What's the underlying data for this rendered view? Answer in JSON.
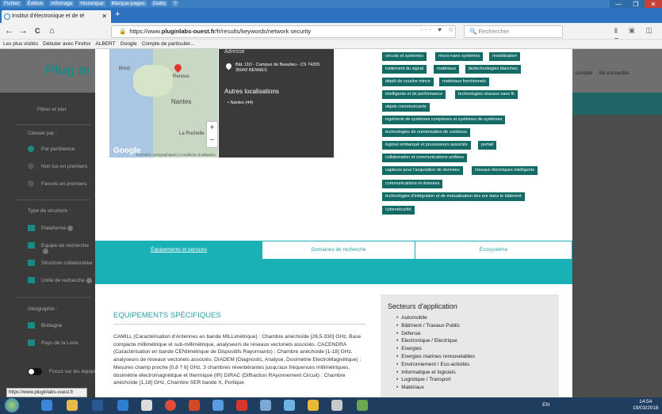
{
  "menubar": {
    "items": [
      "Fichier",
      "Édition",
      "Affichage",
      "Historique",
      "Marque-pages",
      "Outils",
      "?"
    ]
  },
  "window": {
    "minimize": "—",
    "restore": "❐",
    "close": "✕"
  },
  "tab": {
    "title": "Institut d'électronique et de té",
    "close": "✕",
    "new": "+"
  },
  "nav": {
    "back": "←",
    "forward": "→",
    "reload": "C",
    "home": "⌂"
  },
  "url": {
    "prefix": "https://www.",
    "domain": "pluginlabs-ouest.fr",
    "path": "/fr/results/keywords/network security",
    "icons": "··· ♥ ☆"
  },
  "search": {
    "placeholder": "Rechercher"
  },
  "toolbar_right": "⫴ ▣ ◫ ≡",
  "bookmarks": [
    "Les plus visités",
    "Débuter avec Firefox",
    "ALBERT",
    "Google",
    "Compte de particulier..."
  ],
  "site": {
    "logo": "Plug in",
    "links": [
      "compte",
      "Se connecter"
    ]
  },
  "sidebar": {
    "filter": "Filtrer et trier",
    "sort_label": "Classer par :",
    "sort_options": [
      "Par pertinence",
      "Non lus en premiers",
      "Favoris en premiers"
    ],
    "type_label": "Type de structure :",
    "types": [
      "Plateforme",
      "Equipe de recherche",
      "Structure collaborative",
      "Unité de recherche"
    ],
    "geo_label": "Géographie :",
    "regions": [
      "Bretagne",
      "Pays de la Loire"
    ],
    "focus": "Focus sur les équipements"
  },
  "map": {
    "labels": [
      "Brest",
      "Rennes",
      "Nantes",
      "La Rochelle"
    ],
    "zoom_in": "+",
    "zoom_out": "−",
    "google": "Google",
    "credits": "Données cartographiques | Conditions d'utilisation"
  },
  "address": {
    "heading": "Adresse",
    "line1": "Bât. 11D - Campus de Beaulieu - CS 74205",
    "line2": "35042 RENNES",
    "other_heading": "Autres localisations",
    "other_item": "Nantes (44)"
  },
  "tags": [
    "circuits et systèmes",
    "micro-nano systèmes",
    "modélisation",
    "traitement du signal",
    "matériaux",
    "biotechnologies blanches",
    "dépôt de couche mince",
    "matériaux fonctionnels",
    "intelligents et de performance",
    "technologies réseaux sans fil",
    "objets communicants",
    "ingénierie de systèmes complexes et systèmes de systèmes",
    "technologies de numérisation de contenus",
    "logiciel embarqué et processeurs associés",
    "portail",
    "collaboration et communications unifiées",
    "capteurs pour l'acquisition de données",
    "réseaux électriques intelligents",
    "communications et données",
    "technologies d'intégration et de mutualisation des enr dans le bâtiment",
    "cybersécurité"
  ],
  "tabs": [
    "Équipements et services",
    "Domaines de recherche",
    "Écosystème"
  ],
  "equipment": {
    "title": "EQUIPEMENTS SPÉCIFIQUES",
    "text": "CAMILL (Caractérisation d'Antennes en bande MILLimétrique) : Chambre anéchoïde [26,5-330] GHz, Base compacte millimétrique et sub-millimétrique, analyseurs de réseaux vectoriels associés. CACENDRA (Caractérisation en bande CENtimétrique de Dispositifs Rayonnants) : Chambre anéchoïde [1-18] GHz, analyseurs de réseaux vectoriels associés. DIADEM (Diagnostic, Analyse, Dosimétrie ElectroMagnétique) : Mesures champ proche [0,8 ? 6] GHz, 3 chambres réverbérantes jusqu'aux fréquences millimétriques, dosimétrie électromagnétique et thermique (IR) DIRAC (Diffraction RAyonnement Circuit) : Chambre anéchoïde [1,18] GHz, Chambre SER bande X, Portique"
  },
  "sectors": {
    "title": "Secteurs d'application",
    "items": [
      "Automobile",
      "Bâtiment / Travaux Public",
      "Défense",
      "Electronique / Electrique",
      "Energies",
      "Energies marines renouvelables",
      "Environnement / Eco-activités",
      "Informatique et logiciels",
      "Logistique / Transport",
      "Matériaux"
    ]
  },
  "status_url": "https://www.pluginlabs-ouest.fr",
  "taskbar": {
    "tray": "EN",
    "time": "14:54",
    "date": "19/03/2018"
  }
}
